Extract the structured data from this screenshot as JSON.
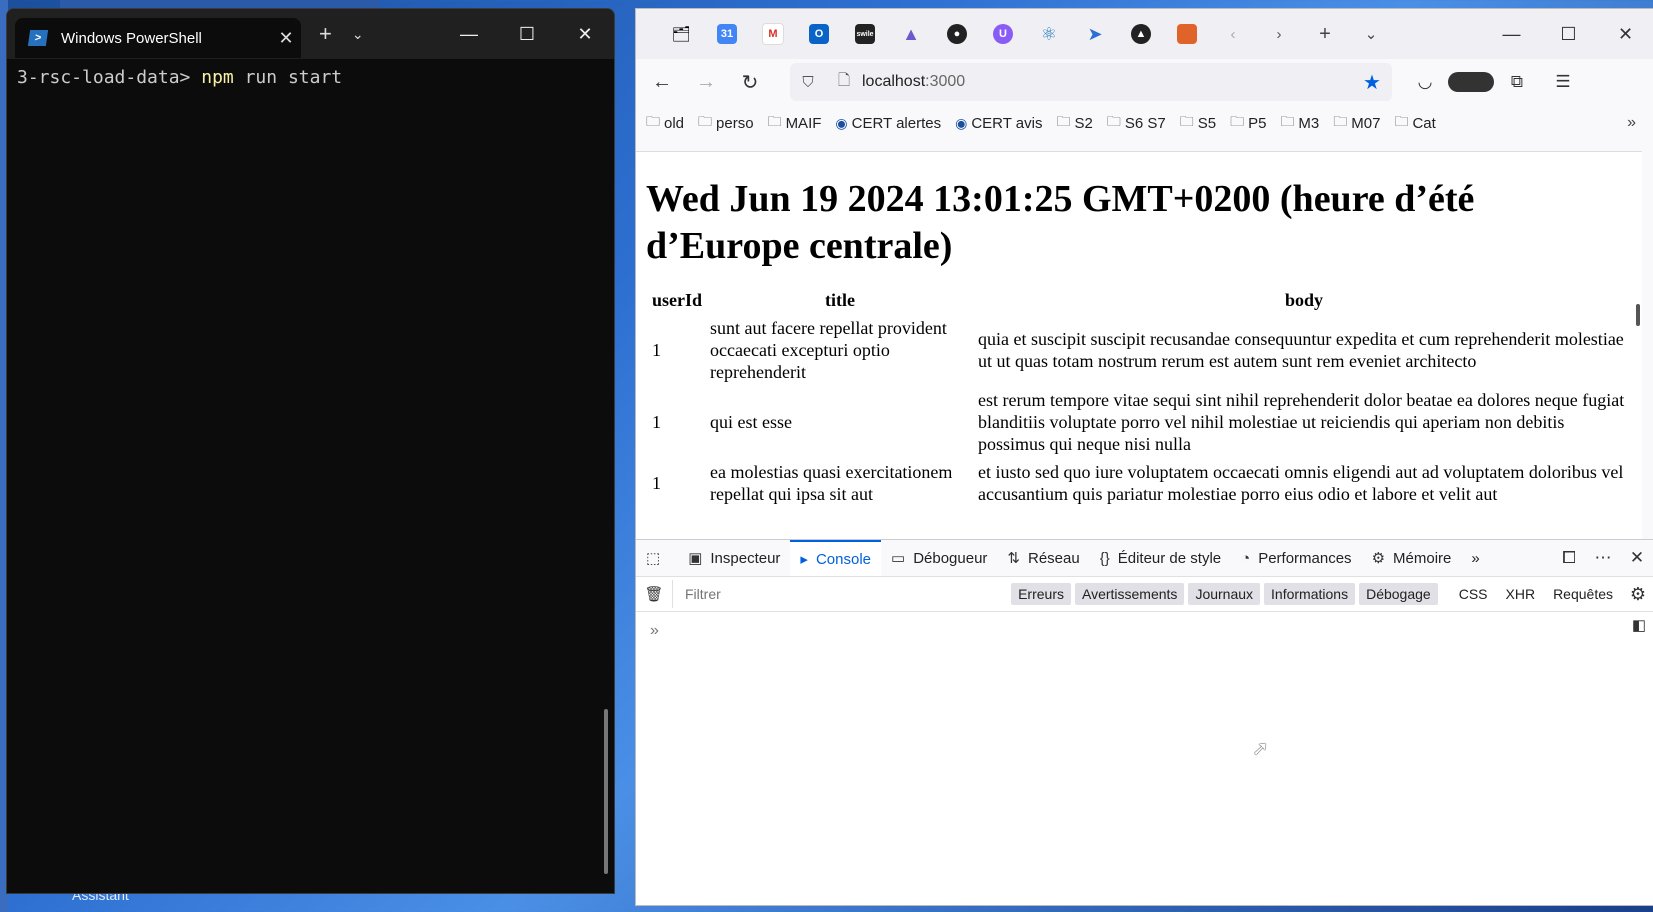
{
  "desktop": {
    "label": "Assistant"
  },
  "terminal": {
    "tab_title": "Windows PowerShell",
    "ps_glyph": ">",
    "prompt": "3-rsc-load-data>",
    "cmd_npm": "npm",
    "cmd_rest": "run start"
  },
  "browser": {
    "url_host": "localhost",
    "url_port": ":3000",
    "bookmarks": [
      {
        "label": "old"
      },
      {
        "label": "perso"
      },
      {
        "label": "MAIF"
      },
      {
        "label": "CERT alertes"
      },
      {
        "label": "CERT avis"
      },
      {
        "label": "S2"
      },
      {
        "label": "S6 S7"
      },
      {
        "label": "S5"
      },
      {
        "label": "P5"
      },
      {
        "label": "M3"
      },
      {
        "label": "M07"
      },
      {
        "label": "Cat"
      }
    ],
    "page": {
      "heading": "Wed Jun 19 2024 13:01:25 GMT+0200 (heure d’été d’Europe centrale)",
      "table": {
        "headers": [
          "userId",
          "title",
          "body"
        ],
        "rows": [
          {
            "userId": "1",
            "title": "sunt aut facere repellat provident occaecati excepturi optio reprehenderit",
            "body": "quia et suscipit suscipit recusandae consequuntur expedita et cum reprehenderit molestiae ut ut quas totam nostrum rerum est autem sunt rem eveniet architecto"
          },
          {
            "userId": "1",
            "title": "qui est esse",
            "body": "est rerum tempore vitae sequi sint nihil reprehenderit dolor beatae ea dolores neque fugiat blanditiis voluptate porro vel nihil molestiae ut reiciendis qui aperiam non debitis possimus qui neque nisi nulla"
          },
          {
            "userId": "1",
            "title": "ea molestias quasi exercitationem repellat qui ipsa sit aut",
            "body": "et iusto sed quo iure voluptatem occaecati omnis eligendi aut ad voluptatem doloribus vel accusantium quis pariatur molestiae porro eius odio et labore et velit aut"
          }
        ]
      }
    },
    "devtools": {
      "tabs": [
        "Inspecteur",
        "Console",
        "Débogueur",
        "Réseau",
        "Éditeur de style",
        "Performances",
        "Mémoire"
      ],
      "filter_placeholder": "Filtrer",
      "chips": [
        "Erreurs",
        "Avertissements",
        "Journaux",
        "Informations",
        "Débogage"
      ],
      "plain": [
        "CSS",
        "XHR",
        "Requêtes"
      ]
    }
  }
}
